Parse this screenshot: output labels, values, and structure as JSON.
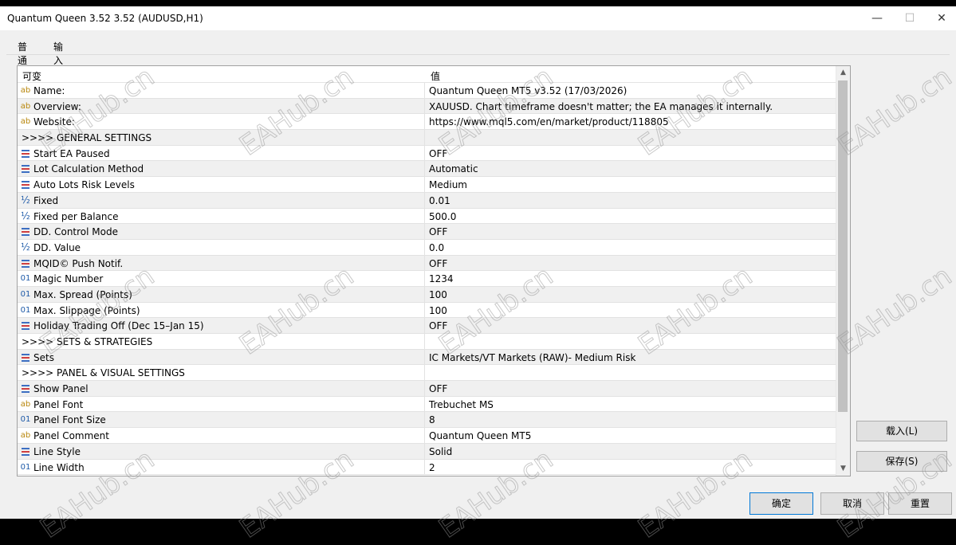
{
  "window": {
    "title": "Quantum Queen 3.52 3.52 (AUDUSD,H1)",
    "minimize": "—",
    "maximize": "☐",
    "close": "✕"
  },
  "tabs": [
    {
      "label": "普通"
    },
    {
      "label": "输入"
    }
  ],
  "grid": {
    "col_variable": "可变",
    "col_value": "值",
    "rows": [
      {
        "icon": "ab",
        "name": "Name:",
        "value": "Quantum Queen MT5 v3.52 (17/03/2026)"
      },
      {
        "icon": "ab",
        "name": "Overview:",
        "value": "XAUUSD. Chart timeframe doesn't matter; the EA manages it internally."
      },
      {
        "icon": "ab",
        "name": "Website:",
        "value": "https://www.mql5.com/en/market/product/118805"
      },
      {
        "icon": "",
        "name": ">>>> GENERAL SETTINGS",
        "value": ""
      },
      {
        "icon": "enum",
        "name": "Start EA Paused",
        "value": "OFF"
      },
      {
        "icon": "enum",
        "name": "Lot Calculation Method",
        "value": "Automatic"
      },
      {
        "icon": "enum",
        "name": "Auto Lots Risk Levels",
        "value": "Medium"
      },
      {
        "icon": "½",
        "name": "Fixed",
        "value": "0.01"
      },
      {
        "icon": "½",
        "name": "Fixed per Balance",
        "value": "500.0"
      },
      {
        "icon": "enum",
        "name": "DD. Control Mode",
        "value": "OFF"
      },
      {
        "icon": "½",
        "name": "DD. Value",
        "value": "0.0"
      },
      {
        "icon": "enum",
        "name": "MQID© Push Notif.",
        "value": "OFF"
      },
      {
        "icon": "01",
        "name": "Magic Number",
        "value": "1234"
      },
      {
        "icon": "01",
        "name": "Max. Spread (Points)",
        "value": "100"
      },
      {
        "icon": "01",
        "name": "Max. Slippage (Points)",
        "value": "100"
      },
      {
        "icon": "enum",
        "name": "Holiday Trading Off (Dec 15–Jan 15)",
        "value": "OFF"
      },
      {
        "icon": "",
        "name": ">>>> SETS & STRATEGIES",
        "value": ""
      },
      {
        "icon": "enum",
        "name": "Sets",
        "value": "IC Markets/VT Markets (RAW)- Medium Risk"
      },
      {
        "icon": "",
        "name": ">>>> PANEL & VISUAL SETTINGS",
        "value": ""
      },
      {
        "icon": "enum",
        "name": "Show Panel",
        "value": "OFF"
      },
      {
        "icon": "ab",
        "name": "Panel Font",
        "value": "Trebuchet MS"
      },
      {
        "icon": "01",
        "name": "Panel Font Size",
        "value": "8"
      },
      {
        "icon": "ab",
        "name": "Panel Comment",
        "value": "Quantum Queen MT5"
      },
      {
        "icon": "enum",
        "name": "Line Style",
        "value": "Solid"
      },
      {
        "icon": "01",
        "name": "Line Width",
        "value": "2"
      }
    ]
  },
  "buttons": {
    "load": "载入(L)",
    "save": "保存(S)",
    "ok": "确定",
    "cancel": "取消",
    "reset": "重置"
  },
  "watermark": "EAHub.cn"
}
